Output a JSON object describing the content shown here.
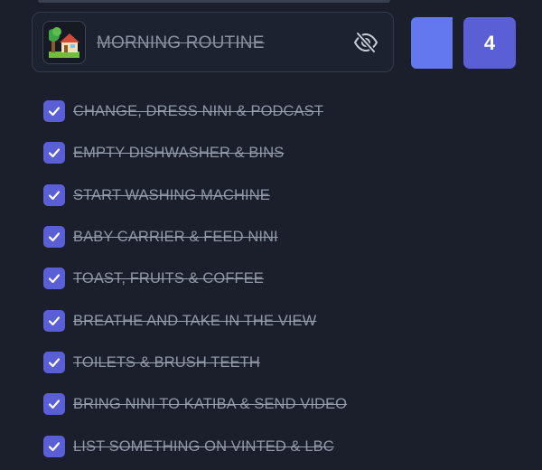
{
  "routine": {
    "emoji": "🏡",
    "title": "MORNING ROUTINE",
    "visibility_icon": "eye-off-icon",
    "count": "4"
  },
  "tasks": [
    {
      "label": "CHANGE, DRESS NINI & PODCAST",
      "checked": true
    },
    {
      "label": "EMPTY DISHWASHER & BINS",
      "checked": true
    },
    {
      "label": "START WASHING MACHINE",
      "checked": true
    },
    {
      "label": "BABY CARRIER & FEED NINI",
      "checked": true
    },
    {
      "label": "TOAST, FRUITS & COFFEE",
      "checked": true
    },
    {
      "label": "BREATHE AND TAKE IN THE VIEW",
      "checked": true
    },
    {
      "label": "TOILETS & BRUSH TEETH",
      "checked": true
    },
    {
      "label": "BRING NINI TO KATIBA & SEND VIDEO",
      "checked": true
    },
    {
      "label": "LIST SOMETHING ON VINTED & LBC",
      "checked": true
    }
  ],
  "colors": {
    "background": "#1b1f2c",
    "accent": "#5b5fd6",
    "accent_light": "#6377ee",
    "muted_text": "#8f96a6"
  }
}
